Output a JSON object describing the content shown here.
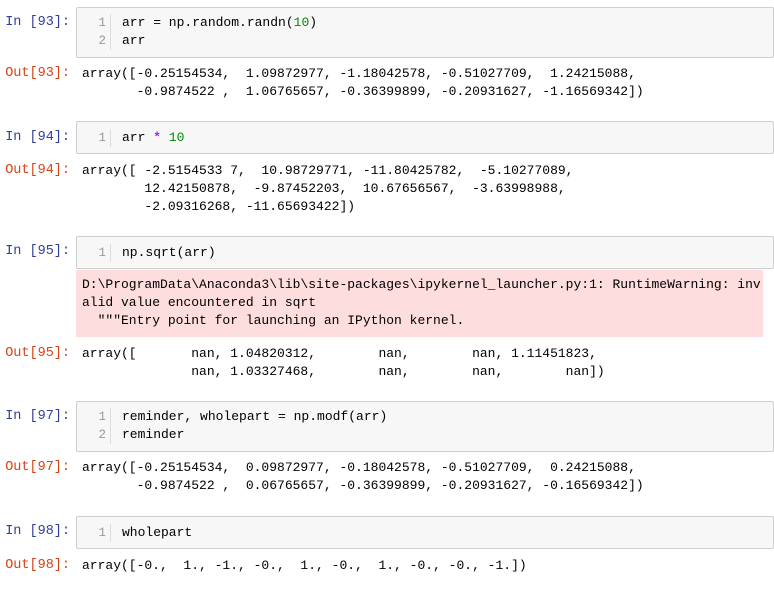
{
  "cells": [
    {
      "in_prompt": "In [93]:",
      "lines": [
        {
          "n": "1",
          "parts": [
            "arr = np.random.randn(",
            "10",
            ")"
          ]
        },
        {
          "n": "2",
          "text": "arr"
        }
      ],
      "out_prompt": "Out[93]:",
      "out_lines": [
        "array([-0.25154534,  1.09872977, -1.18042578, -0.51027709,  1.24215088,",
        "       -0.9874522 ,  1.06765657, -0.36399899, -0.20931627, -1.16569342])"
      ]
    },
    {
      "in_prompt": "In [94]:",
      "lines": [
        {
          "n": "1",
          "parts": [
            "arr ",
            "*",
            " ",
            "10"
          ]
        }
      ],
      "out_prompt": "Out[94]:",
      "out_lines": [
        "array([ -2.5154533 7,  10.98729771, -11.80425782,  -5.10277089,",
        "        12.42150878,  -9.87452203,  10.67656567,  -3.63998988,",
        "        -2.09316268, -11.65693422])"
      ]
    },
    {
      "in_prompt": "In [95]:",
      "lines": [
        {
          "n": "1",
          "text": "np.sqrt(arr)"
        }
      ],
      "stderr_lines": [
        "D:\\ProgramData\\Anaconda3\\lib\\site-packages\\ipykernel_launcher.py:1: RuntimeWarning: inv",
        "alid value encountered in sqrt",
        "  \"\"\"Entry point for launching an IPython kernel."
      ],
      "out_prompt": "Out[95]:",
      "out_lines": [
        "array([       nan, 1.04820312,        nan,        nan, 1.11451823,",
        "              nan, 1.03327468,        nan,        nan,        nan])"
      ]
    },
    {
      "in_prompt": "In [97]:",
      "lines": [
        {
          "n": "1",
          "text": "reminder, wholepart = np.modf(arr)"
        },
        {
          "n": "2",
          "text": "reminder"
        }
      ],
      "out_prompt": "Out[97]:",
      "out_lines": [
        "array([-0.25154534,  0.09872977, -0.18042578, -0.51027709,  0.24215088,",
        "       -0.9874522 ,  0.06765657, -0.36399899, -0.20931627, -0.16569342])"
      ]
    },
    {
      "in_prompt": "In [98]:",
      "lines": [
        {
          "n": "1",
          "text": "wholepart"
        }
      ],
      "out_prompt": "Out[98]:",
      "out_lines": [
        "array([-0.,  1., -1., -0.,  1., -0.,  1., -0., -0., -1.])"
      ]
    }
  ]
}
